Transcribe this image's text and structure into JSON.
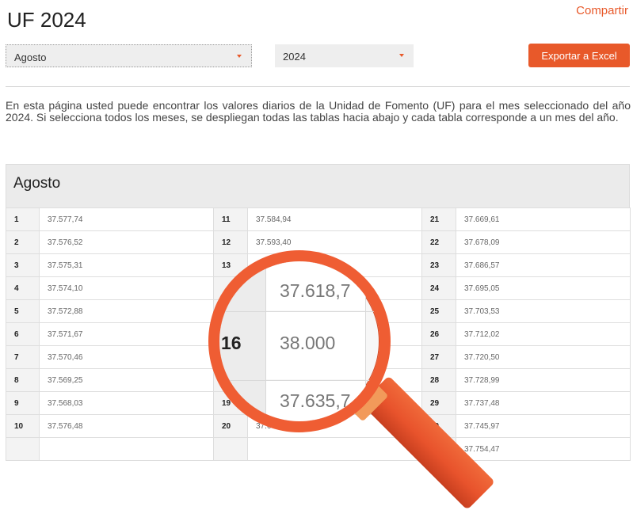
{
  "header": {
    "title": "UF 2024",
    "share_label": "Compartir"
  },
  "filters": {
    "month": "Agosto",
    "year": "2024",
    "export_label": "Exportar a Excel"
  },
  "intro": "En esta página usted puede encontrar los valores diarios de la Unidad de Fomento (UF) para el mes seleccionado del año 2024. Si selecciona todos los meses, se despliegan todas las tablas hacia abajo y cada tabla corresponde a un mes del año.",
  "table": {
    "month": "Agosto",
    "rows": [
      [
        {
          "d": "1",
          "v": "37.577,74"
        },
        {
          "d": "11",
          "v": "37.584,94"
        },
        {
          "d": "21",
          "v": "37.669,61"
        }
      ],
      [
        {
          "d": "2",
          "v": "37.576,52"
        },
        {
          "d": "12",
          "v": "37.593,40"
        },
        {
          "d": "22",
          "v": "37.678,09"
        }
      ],
      [
        {
          "d": "3",
          "v": "37.575,31"
        },
        {
          "d": "13",
          "v": ""
        },
        {
          "d": "23",
          "v": "37.686,57"
        }
      ],
      [
        {
          "d": "4",
          "v": "37.574,10"
        },
        {
          "d": "",
          "v": ""
        },
        {
          "d": "24",
          "v": "37.695,05"
        }
      ],
      [
        {
          "d": "5",
          "v": "37.572,88"
        },
        {
          "d": "",
          "v": ""
        },
        {
          "d": "25",
          "v": "37.703,53"
        }
      ],
      [
        {
          "d": "6",
          "v": "37.571,67"
        },
        {
          "d": "",
          "v": ""
        },
        {
          "d": "26",
          "v": "37.712,02"
        }
      ],
      [
        {
          "d": "7",
          "v": "37.570,46"
        },
        {
          "d": "",
          "v": ""
        },
        {
          "d": "27",
          "v": "37.720,50"
        }
      ],
      [
        {
          "d": "8",
          "v": "37.569,25"
        },
        {
          "d": "",
          "v": ""
        },
        {
          "d": "28",
          "v": "37.728,99"
        }
      ],
      [
        {
          "d": "9",
          "v": "37.568,03"
        },
        {
          "d": "19",
          "v": ""
        },
        {
          "d": "29",
          "v": "37.737,48"
        }
      ],
      [
        {
          "d": "10",
          "v": "37.576,48"
        },
        {
          "d": "20",
          "v": "37.661,13"
        },
        {
          "d": "30",
          "v": "37.745,97"
        }
      ],
      [
        {
          "d": "",
          "v": ""
        },
        {
          "d": "",
          "v": ""
        },
        {
          "d": "",
          "v": "37.754,47"
        }
      ]
    ]
  },
  "magnifier": {
    "value_top": "37.618,7",
    "day_mid": "16",
    "value_mid": "38.000",
    "value_bottom": "37.635,7"
  },
  "colors": {
    "accent": "#e8592a",
    "magnifier_ring": "#ef5d33"
  },
  "icons": {
    "dropdown": "caret-down-icon",
    "magnifier": "magnifying-glass-icon"
  }
}
